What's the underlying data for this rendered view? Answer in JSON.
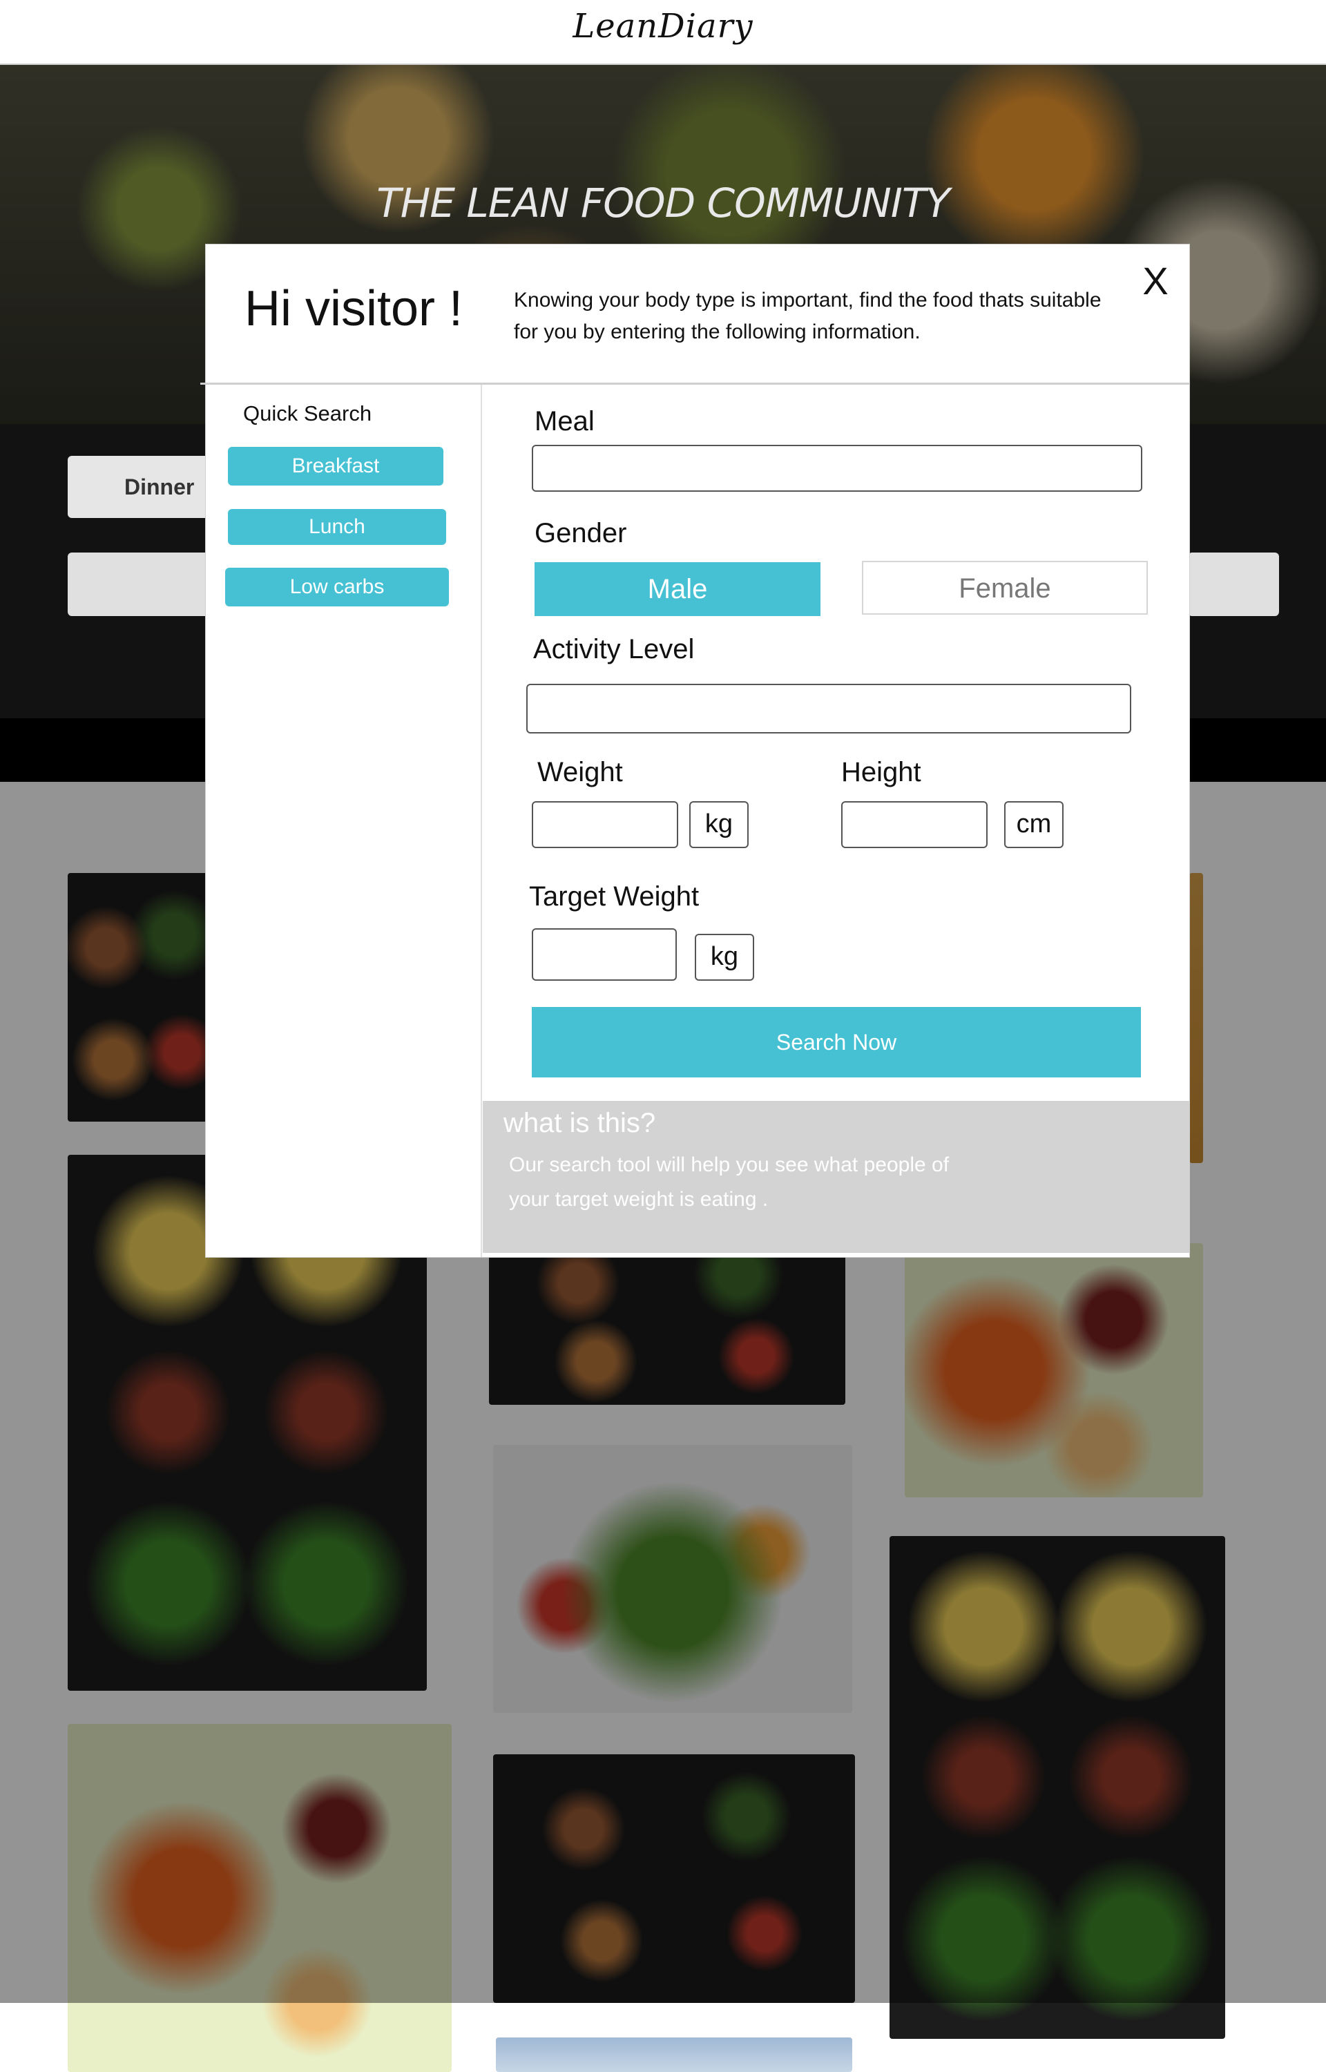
{
  "site": {
    "logo": "LeanDiary",
    "hero_title": "THE LEAN FOOD COMMUNITY",
    "background_filter_label": "Dinner"
  },
  "modal": {
    "greeting": "Hi visitor !",
    "intro": "Knowing your body type is important, find the food thats suitable for you by entering the following information.",
    "close_label": "X",
    "quick_search": {
      "title": "Quick Search",
      "items": [
        {
          "label": "Breakfast"
        },
        {
          "label": "Lunch"
        },
        {
          "label": "Low carbs"
        }
      ]
    },
    "form": {
      "meal_label": "Meal",
      "meal_value": "",
      "gender_label": "Gender",
      "gender_options": [
        {
          "label": "Male",
          "selected": true
        },
        {
          "label": "Female",
          "selected": false
        }
      ],
      "activity_label": "Activity Level",
      "activity_value": "",
      "weight_label": "Weight",
      "weight_value": "",
      "weight_unit": "kg",
      "height_label": "Height",
      "height_value": "",
      "height_unit": "cm",
      "target_weight_label": "Target Weight",
      "target_weight_value": "",
      "target_weight_unit": "kg",
      "search_button": "Search Now"
    },
    "info": {
      "title": "what is this?",
      "text": "Our search tool will help you see what people of your target weight is eating ."
    }
  },
  "colors": {
    "accent": "#45c1d3",
    "info_panel": "#d3d3d3",
    "overlay_dark": "#121212"
  }
}
